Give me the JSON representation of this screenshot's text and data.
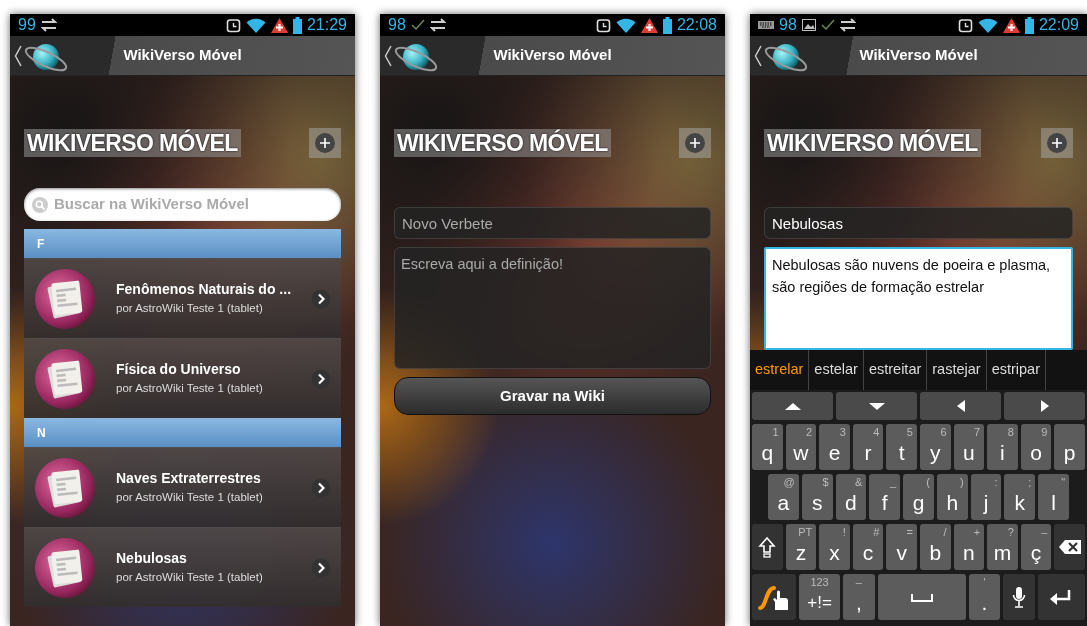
{
  "phones": [
    {
      "kind": "list",
      "status_bar": {
        "left": [
          {
            "kind": "count",
            "text": "99"
          },
          {
            "kind": "sync"
          }
        ],
        "time": "21:29"
      },
      "title": "WikiVerso Móvel",
      "heading": "WIKIVERSO MÓVEL",
      "search": {
        "placeholder": "Buscar na WikiVerso Móvel"
      },
      "sections": [
        {
          "letter": "F",
          "items": [
            {
              "title": "Fenômenos Naturais do ...",
              "subtitle": "por AstroWiki Teste 1 (tablet)"
            },
            {
              "title": "Física do Universo",
              "subtitle": "por AstroWiki Teste 1 (tablet)"
            }
          ]
        },
        {
          "letter": "N",
          "items": [
            {
              "title": "Naves Extraterrestres",
              "subtitle": "por AstroWiki Teste 1 (tablet)"
            },
            {
              "title": "Nebulosas",
              "subtitle": "por AstroWiki Teste 1 (tablet)"
            }
          ]
        }
      ]
    },
    {
      "kind": "form",
      "status_bar": {
        "left": [
          {
            "kind": "count",
            "text": "98"
          },
          {
            "kind": "check"
          },
          {
            "kind": "sync"
          }
        ],
        "time": "22:08"
      },
      "title": "WikiVerso Móvel",
      "heading": "WIKIVERSO MÓVEL",
      "form": {
        "title_field": {
          "placeholder": "Novo Verbete"
        },
        "definition_field": {
          "placeholder": "Escreva aqui a definição!",
          "focused": false
        },
        "save_button": "Gravar na Wiki"
      }
    },
    {
      "kind": "form",
      "status_bar": {
        "left": [
          {
            "kind": "keyboard"
          },
          {
            "kind": "count",
            "text": "98"
          },
          {
            "kind": "image"
          },
          {
            "kind": "check"
          },
          {
            "kind": "sync"
          }
        ],
        "time": "22:09"
      },
      "title": "WikiVerso Móvel",
      "heading": "WIKIVERSO MÓVEL",
      "form": {
        "title_field": {
          "value": "Nebulosas"
        },
        "definition_field": {
          "value": "Nebulosas são nuvens de poeira e plasma, são regiões de formação estrelar",
          "focused": true
        }
      },
      "keyboard": {
        "suggestions": [
          {
            "text": "estrelar",
            "selected": true
          },
          {
            "text": "estelar",
            "selected": false
          },
          {
            "text": "estreitar",
            "selected": false
          },
          {
            "text": "rastejar",
            "selected": false
          },
          {
            "text": "estripar",
            "selected": false
          }
        ],
        "rows": [
          {
            "keys": [
              {
                "kind": "up"
              },
              {
                "kind": "down"
              },
              {
                "kind": "left"
              },
              {
                "kind": "right"
              }
            ]
          },
          {
            "keys": [
              {
                "kind": "char",
                "label": "q",
                "hint": "1"
              },
              {
                "kind": "char",
                "label": "w",
                "hint": "2"
              },
              {
                "kind": "char",
                "label": "e",
                "hint": "3"
              },
              {
                "kind": "char",
                "label": "r",
                "hint": "4"
              },
              {
                "kind": "char",
                "label": "t",
                "hint": "5"
              },
              {
                "kind": "char",
                "label": "y",
                "hint": "6"
              },
              {
                "kind": "char",
                "label": "u",
                "hint": "7"
              },
              {
                "kind": "char",
                "label": "i",
                "hint": "8"
              },
              {
                "kind": "char",
                "label": "o",
                "hint": "9"
              },
              {
                "kind": "char",
                "label": "p"
              }
            ]
          },
          {
            "keys": [
              {
                "kind": "char",
                "label": "a",
                "hint": "@"
              },
              {
                "kind": "char",
                "label": "s",
                "hint": "$"
              },
              {
                "kind": "char",
                "label": "d",
                "hint": "&"
              },
              {
                "kind": "char",
                "label": "f",
                "hint": "_"
              },
              {
                "kind": "char",
                "label": "g",
                "hint": "("
              },
              {
                "kind": "char",
                "label": "h",
                "hint": ")"
              },
              {
                "kind": "char",
                "label": "j",
                "hint": ":"
              },
              {
                "kind": "char",
                "label": "k",
                "hint": ";"
              },
              {
                "kind": "char",
                "label": "l",
                "hint": "\""
              }
            ]
          },
          {
            "keys": [
              {
                "kind": "shift"
              },
              {
                "kind": "char",
                "label": "z",
                "hint": "PT"
              },
              {
                "kind": "char",
                "label": "x",
                "hint": "!"
              },
              {
                "kind": "char",
                "label": "c",
                "hint": "#"
              },
              {
                "kind": "char",
                "label": "v",
                "hint": "="
              },
              {
                "kind": "char",
                "label": "b",
                "hint": "/"
              },
              {
                "kind": "char",
                "label": "n",
                "hint": "+"
              },
              {
                "kind": "char",
                "label": "m",
                "hint": "?"
              },
              {
                "kind": "char",
                "label": "ç",
                "hint": "–"
              },
              {
                "kind": "backspace"
              }
            ]
          },
          {
            "keys": [
              {
                "kind": "swype"
              },
              {
                "kind": "char",
                "label": "+!=",
                "hint": "123"
              },
              {
                "kind": "char",
                "label": ",",
                "hint": "–"
              },
              {
                "kind": "space"
              },
              {
                "kind": "char",
                "label": ".",
                "hint": "'"
              },
              {
                "kind": "mic"
              },
              {
                "kind": "enter"
              }
            ]
          }
        ]
      }
    }
  ]
}
